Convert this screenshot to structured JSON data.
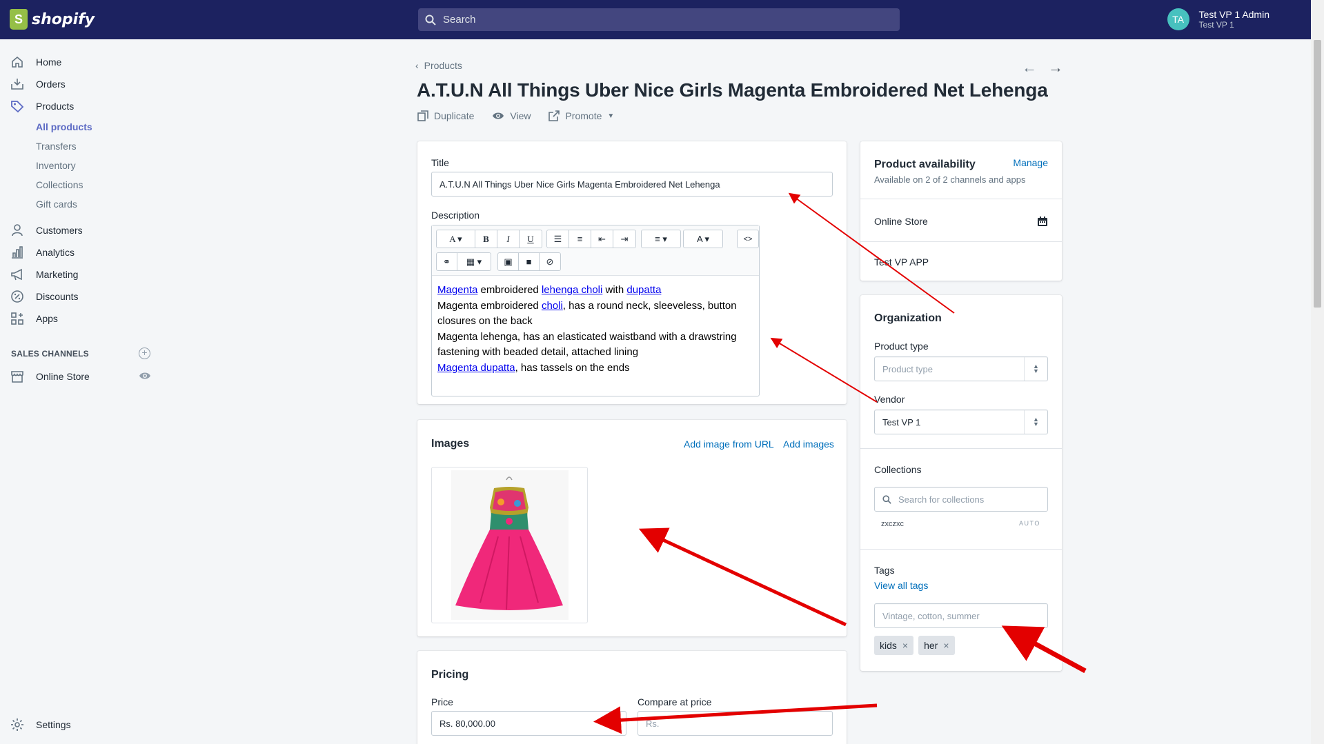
{
  "topbar": {
    "brand": "shopify",
    "search_placeholder": "Search",
    "user_initials": "TA",
    "user_name": "Test VP 1 Admin",
    "shop_name": "Test VP 1"
  },
  "sidebar": {
    "items": [
      {
        "label": "Home",
        "icon": "home-icon"
      },
      {
        "label": "Orders",
        "icon": "orders-icon"
      },
      {
        "label": "Products",
        "icon": "tag-icon"
      },
      {
        "label": "Customers",
        "icon": "person-icon"
      },
      {
        "label": "Analytics",
        "icon": "bar-chart-icon"
      },
      {
        "label": "Marketing",
        "icon": "megaphone-icon"
      },
      {
        "label": "Discounts",
        "icon": "discount-icon"
      },
      {
        "label": "Apps",
        "icon": "apps-icon"
      }
    ],
    "product_subitems": [
      "All products",
      "Transfers",
      "Inventory",
      "Collections",
      "Gift cards"
    ],
    "sales_channels_label": "SALES CHANNELS",
    "online_store": "Online Store",
    "settings": "Settings"
  },
  "header": {
    "breadcrumb": "Products",
    "title": "A.T.U.N All Things Uber Nice Girls Magenta Embroidered Net Lehenga",
    "actions": {
      "duplicate": "Duplicate",
      "view": "View",
      "promote": "Promote"
    }
  },
  "main": {
    "title_label": "Title",
    "title_value": "A.T.U.N All Things Uber Nice Girls Magenta Embroidered Net Lehenga",
    "description_label": "Description",
    "description": {
      "l1_a": "Magenta",
      "l1_b": " embroidered ",
      "l1_c": "lehenga choli",
      "l1_d": " with ",
      "l1_e": "dupatta",
      "l2_a": "Magenta embroidered ",
      "l2_b": "choli",
      "l2_c": ", has a round neck, sleeveless, button closures on the back",
      "l3": "Magenta lehenga, has an elasticated waistband with a drawstring fastening with beaded detail, attached lining",
      "l4_a": "Magenta dupatta",
      "l4_b": ", has tassels on the ends"
    },
    "images": {
      "heading": "Images",
      "add_url": "Add image from URL",
      "add_images": "Add images"
    },
    "pricing": {
      "heading": "Pricing",
      "price_label": "Price",
      "price_value": "Rs. 80,000.00",
      "compare_label": "Compare at price",
      "compare_placeholder": "Rs."
    }
  },
  "aside": {
    "availability": {
      "heading": "Product availability",
      "manage": "Manage",
      "summary": "Available on 2 of 2 channels and apps",
      "channels": [
        "Online Store",
        "Test VP APP"
      ]
    },
    "organization": {
      "heading": "Organization",
      "product_type_label": "Product type",
      "product_type_placeholder": "Product type",
      "vendor_label": "Vendor",
      "vendor_value": "Test VP 1",
      "collections_label": "Collections",
      "collections_placeholder": "Search for collections",
      "collection_item": "zxczxc",
      "collection_badge": "AUTO",
      "tags_label": "Tags",
      "view_all_tags": "View all tags",
      "tags_placeholder": "Vintage, cotton, summer",
      "tags": [
        "kids",
        "her"
      ]
    }
  },
  "colors": {
    "topbar": "#1c2260",
    "accent": "#5c6ac4",
    "link": "#006fbb",
    "annotation": "#e30000",
    "dress": "#f0287a"
  }
}
